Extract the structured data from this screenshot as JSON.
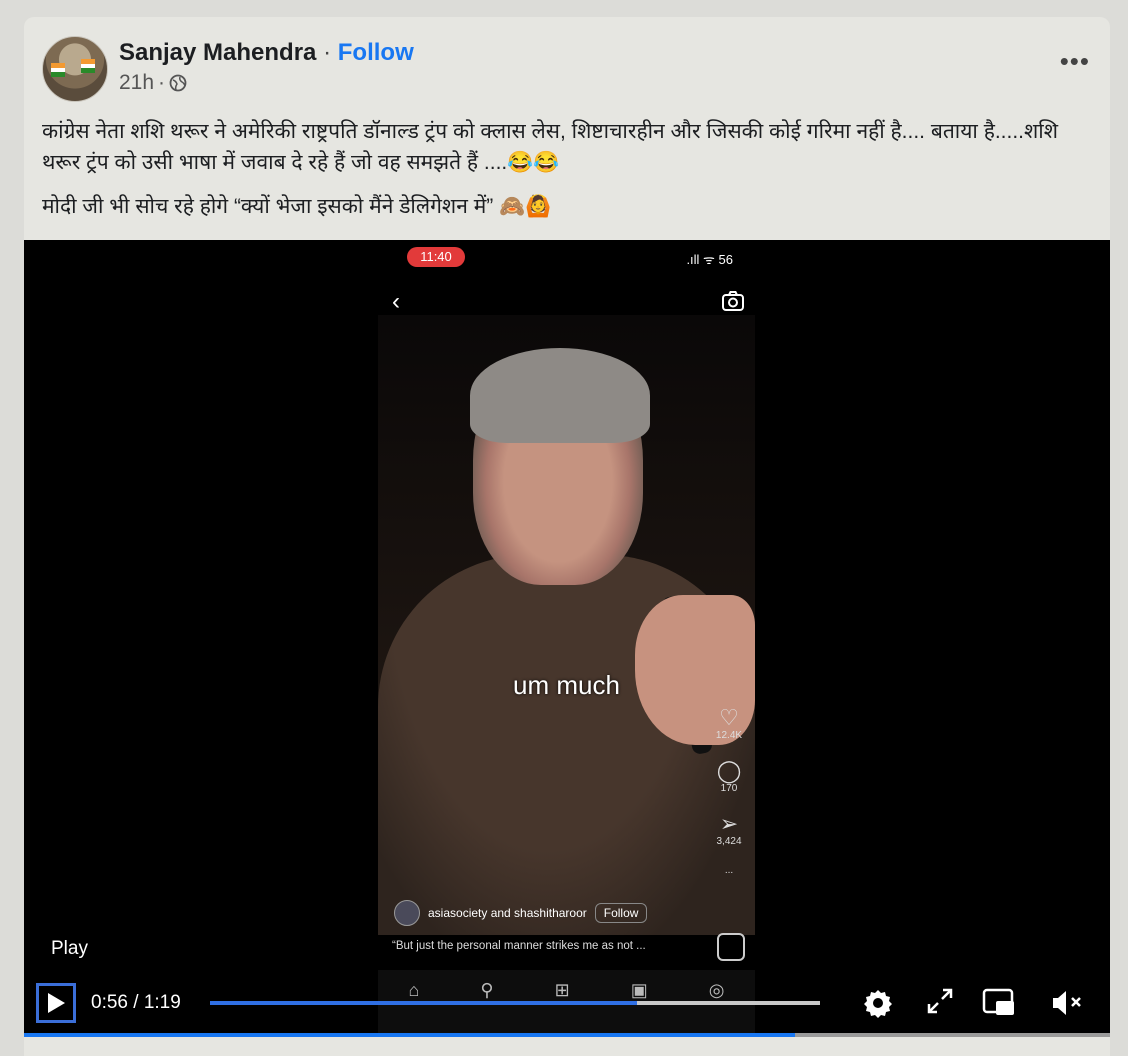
{
  "post": {
    "author": "Sanjay Mahendra",
    "separator": "·",
    "follow_label": "Follow",
    "time": "21h",
    "time_sep": "·",
    "more_label": "•••",
    "text_line1": "कांग्रेस नेता शशि थरूर ने अमेरिकी राष्ट्रपति डॉनाल्ड ट्रंप को क्लास लेस, शिष्टाचारहीन और जिसकी कोई गरिमा नहीं है.... बताया है.....शशि थरूर ट्रंप को उसी भाषा में जवाब दे रहे हैं जो वह समझते हैं ....😂😂",
    "text_line2": "मोदी जी भी सोच रहे होगे “क्यों भेजा इसको मैंने डेलिगेशन में” 🙈🙆"
  },
  "video": {
    "phone_time": "11:40",
    "status_icons": ".ıll ᯤ 56",
    "subtitle": "um much",
    "like_count": "12.4K",
    "comment_count": "170",
    "share_count": "3,424",
    "more_dots": "...",
    "reel_users": "asiasociety and shashitharoor",
    "reel_follow": "Follow",
    "reel_caption": "“But just the personal manner strikes me as not ...",
    "play_label": "Play",
    "current_time": "0:56",
    "time_sep": " / ",
    "duration": "1:19",
    "progress": 0.7,
    "bottom_progress": 0.71
  },
  "colors": {
    "accent": "#1877f2",
    "play_focus": "#3b6fd9",
    "time_pill": "#e23a3a"
  }
}
